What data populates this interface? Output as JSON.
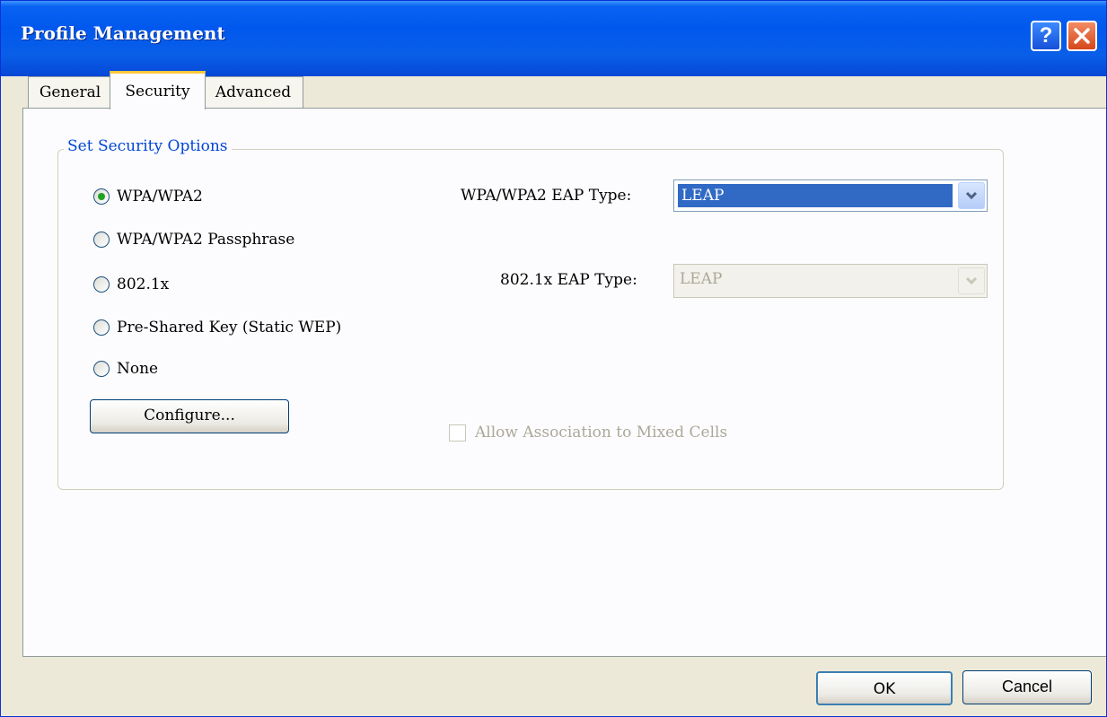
{
  "window": {
    "title": "Profile Management",
    "help_icon": "help-question-icon",
    "close_icon": "close-x-icon",
    "help_glyph": "?"
  },
  "tabs": [
    {
      "label": "General",
      "active": false
    },
    {
      "label": "Security",
      "active": true
    },
    {
      "label": "Advanced",
      "active": false
    }
  ],
  "security": {
    "group_title": "Set Security Options",
    "options": [
      {
        "label": "WPA/WPA2",
        "selected": true
      },
      {
        "label": "WPA/WPA2 Passphrase",
        "selected": false
      },
      {
        "label": "802.1x",
        "selected": false
      },
      {
        "label": "Pre-Shared Key (Static WEP)",
        "selected": false
      },
      {
        "label": "None",
        "selected": false
      }
    ],
    "configure_label": "Configure...",
    "wpa_eap_label": "WPA/WPA2 EAP Type:",
    "wpa_eap_value": "LEAP",
    "dot1x_eap_label": "802.1x EAP Type:",
    "dot1x_eap_value": "LEAP",
    "mixed_cells_label": "Allow Association to Mixed Cells",
    "mixed_cells_checked": false,
    "mixed_cells_enabled": false
  },
  "footer": {
    "ok_label": "OK",
    "cancel_label": "Cancel"
  },
  "colors": {
    "title_bar": "#0058EE",
    "dialog_bg": "#ECE9D8",
    "selection": "#316AC5",
    "group_title": "#0046D5",
    "radio_dot": "#21A121",
    "active_tab_accent": "#FFC83C",
    "disabled_text": "#ACA899"
  }
}
